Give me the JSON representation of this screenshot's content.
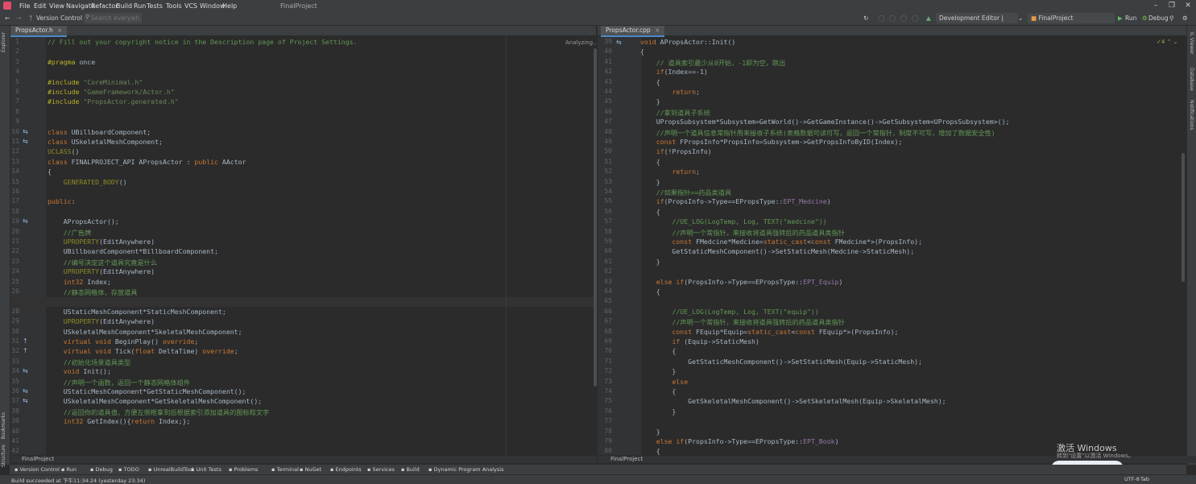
{
  "menu": [
    "File",
    "Edit",
    "View",
    "Navigate",
    "Refactor",
    "Build",
    "Run",
    "Tests",
    "Tools",
    "VCS",
    "Window",
    "Help"
  ],
  "project_title": "FinalProject",
  "toolbar": {
    "vcs": "Version Control",
    "search_placeholder": "Search everywhere",
    "config": "Development Editor | Wi...",
    "project": "FinalProject",
    "run": "Run",
    "debug": "Debug"
  },
  "left_strip": [
    "Explorer",
    "Bookmarks",
    "Structure"
  ],
  "right_strip": [
    "IL Viewer",
    "Database",
    "Notifications"
  ],
  "left_editor": {
    "tab": "PropsActor.h",
    "status": "Analyzing...",
    "breadcrumb": "FinalProject",
    "line_numbers": [
      "1",
      "2",
      "3",
      "4",
      "5",
      "6",
      "7",
      "8",
      "9",
      "10",
      "11",
      "12",
      "13",
      "14",
      "15",
      "16",
      "17",
      "18",
      "19",
      "20",
      "21",
      "22",
      "23",
      "24",
      "25",
      "26",
      "27",
      "28",
      "29",
      "30",
      "31",
      "32",
      "33",
      "34",
      "35",
      "36",
      "37",
      "38",
      "39",
      "40",
      "41",
      "42"
    ],
    "lines": [
      "// Fill out your copyright notice in the Description page of Project Settings.",
      "",
      "#pragma once",
      "",
      "#include \"CoreMinimal.h\"",
      "#include \"GameFramework/Actor.h\"",
      "#include \"PropsActor.generated.h\"",
      "",
      "",
      "class UBillboardComponent;",
      "class USkeletalMeshComponent;",
      "UCLASS()",
      "class FINALPROJECT_API APropsActor : public AActor",
      "{",
      "    GENERATED_BODY()",
      "",
      "public:",
      "",
      "    APropsActor();",
      "    //广告牌",
      "    UPROPERTY(EditAnywhere)",
      "    UBillboardComponent*BillboardComponent;",
      "    //编号决定这个道具究竟是什么",
      "    UPROPERTY(EditAnywhere)",
      "    int32 Index;",
      "    //静态网格体，存放道具",
      "    UPROPERTY(EditAnywhere)",
      "    UStaticMeshComponent*StaticMeshComponent;",
      "    UPROPERTY(EditAnywhere)",
      "    USkeletalMeshComponent*SkeletalMeshComponent;",
      "    virtual void BeginPlay() override;",
      "    virtual void Tick(float DeltaTime) override;",
      "    //初始化场景道具类型",
      "    void Init();",
      "    //声明一个函数，返回一个静态网格体组件",
      "    UStaticMeshComponent*GetStaticMeshComponent();",
      "    USkeletalMeshComponent*GetSkeletalMeshComponent();",
      "    //返回你的道具值，方便左侧框拿到后根据索引添加道具的图标和文字",
      "    int32 GetIndex(){return Index;};",
      "",
      "",
      ""
    ]
  },
  "right_editor": {
    "tab": "PropsActor.cpp",
    "breadcrumb": "FinalProject",
    "inspection": "4",
    "line_numbers": [
      "39",
      "40",
      "41",
      "42",
      "43",
      "44",
      "45",
      "46",
      "47",
      "48",
      "49",
      "50",
      "51",
      "52",
      "53",
      "54",
      "55",
      "56",
      "57",
      "58",
      "59",
      "60",
      "61",
      "62",
      "63",
      "64",
      "65",
      "66",
      "67",
      "68",
      "69",
      "70",
      "71",
      "72",
      "73",
      "74",
      "75",
      "76",
      "77",
      "78",
      "79",
      "80"
    ],
    "lines": [
      "void APropsActor::Init()",
      "{",
      "    // 道具索引最少从0开始，-1即为空，跳出",
      "    if(Index==-1)",
      "    {",
      "        return;",
      "    }",
      "    //拿到道具子系统",
      "    UPropsSubsystem*Subsystem=GetWorld()->GetGameInstance()->GetSubsystem<UPropsSubsystem>();",
      "    //声明一个道具信息常指针用来接收子系统(表格数据可读可写，返回一个常指针，制度不可写，增加了数据安全性)",
      "    const FPropsInfo*PropsInfo=Subsystem->GetPropsInfoByID(Index);",
      "    if(!PropsInfo)",
      "    {",
      "        return;",
      "    }",
      "    //如果指针==药品类道具",
      "    if(PropsInfo->Type==EPropsType::EPT_Medcine)",
      "    {",
      "        //UE_LOG(LogTemp, Log, TEXT(\"medcine\"))",
      "        //声明一个常指针，来接收将道具强转后的药品道具类指针",
      "        const FMedcine*Medcine=static_cast<const FMedcine*>(PropsInfo);",
      "        GetStaticMeshComponent()->SetStaticMesh(Medcine->StaticMesh);",
      "    }",
      "",
      "    else if(PropsInfo->Type==EPropsType::EPT_Equip)",
      "    {",
      "",
      "        //UE_LOG(LogTemp, Log, TEXT(\"equip\"))",
      "        //声明一个常指针，来接收将道具强转后的药品道具类指针",
      "        const FEquip*Equip=static_cast<const FEquip*>(PropsInfo);",
      "        if (Equip->StaticMesh)",
      "        {",
      "            GetStaticMeshComponent()->SetStaticMesh(Equip->StaticMesh);",
      "        }",
      "        else",
      "        {",
      "            GetSkeletalMeshComponent()->SetSkeletalMesh(Equip->SkeletalMesh);",
      "        }",
      "",
      "    }",
      "    else if(PropsInfo->Type==EPropsType::EPT_Book)",
      "    {"
    ]
  },
  "tool_windows": [
    "Version Control",
    "Run",
    "Debug",
    "TODO",
    "UnrealBuildTool",
    "Unit Tests",
    "Problems",
    "Terminal",
    "NuGet",
    "Endpoints",
    "Services",
    "Build",
    "Dynamic Program Analysis"
  ],
  "status": {
    "message": "Build succeeded at 下午11:34:24 (yesterday 23:34)",
    "encoding": "UTF-8",
    "indent": "Tab"
  },
  "windows_activation": {
    "title": "激活 Windows",
    "subtitle": "转到\"设置\"以激活 Windows。"
  },
  "colors": {
    "editor_bg": "#2b2b2b",
    "chrome_bg": "#3c3f41",
    "comment": "#629755",
    "keyword": "#cc7832",
    "string": "#6a8759",
    "tab_underline": "#4a88c7"
  }
}
